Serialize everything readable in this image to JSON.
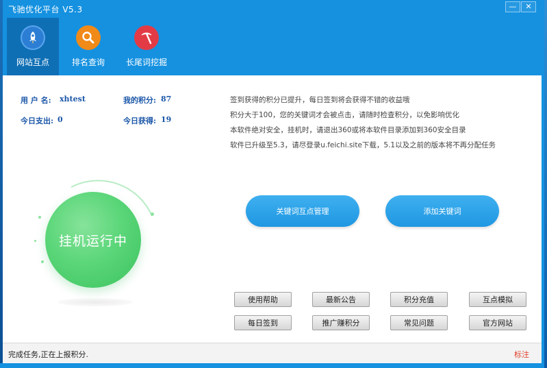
{
  "window": {
    "title": "飞驰优化平台 V5.3",
    "minimize_glyph": "—",
    "close_glyph": "✕"
  },
  "tabs": [
    {
      "label": "网站互点",
      "icon": "rocket-icon",
      "color": "#2b7ed4",
      "active": true
    },
    {
      "label": "排名查询",
      "icon": "magnifier-icon",
      "color": "#f08a18",
      "active": false
    },
    {
      "label": "长尾词挖掘",
      "icon": "pickaxe-icon",
      "color": "#e33b46",
      "active": false
    }
  ],
  "stats": {
    "username_label": "用 户 名:",
    "username_value": "xhtest",
    "points_label": "我的积分:",
    "points_value": "87",
    "spent_label": "今日支出:",
    "spent_value": "0",
    "earned_label": "今日获得:",
    "earned_value": "19"
  },
  "notices": [
    "签到获得的积分已提升，每日签到将会获得不错的收益哦",
    "积分大于100，您的关键词才会被点击，请随时检查积分，以免影响优化",
    "本软件绝对安全，挂机时，请退出360或将本软件目录添加到360安全目录",
    "软件已升级至5.3，请尽登录u.feichi.site下载，5.1以及之前的版本将不再分配任务"
  ],
  "running_status": "挂机运行中",
  "actions": {
    "manage_keywords": "关键词互点管理",
    "add_keyword": "添加关键词"
  },
  "small_buttons": {
    "help": "使用帮助",
    "announcement": "最新公告",
    "recharge": "积分充值",
    "simulate": "互点模拟",
    "checkin": "每日签到",
    "promote": "推广赚积分",
    "faq": "常见问题",
    "website": "官方网站"
  },
  "status_bar": {
    "message": "完成任务,正在上报积分.",
    "link": "标注"
  },
  "colors": {
    "window_blue": "#1591e0",
    "active_tab": "#0f6fb5",
    "pill_blue": "#1f97e2",
    "running_green": "#3cc35e",
    "stat_text": "#1a56a8",
    "link_red": "#e0402a"
  }
}
